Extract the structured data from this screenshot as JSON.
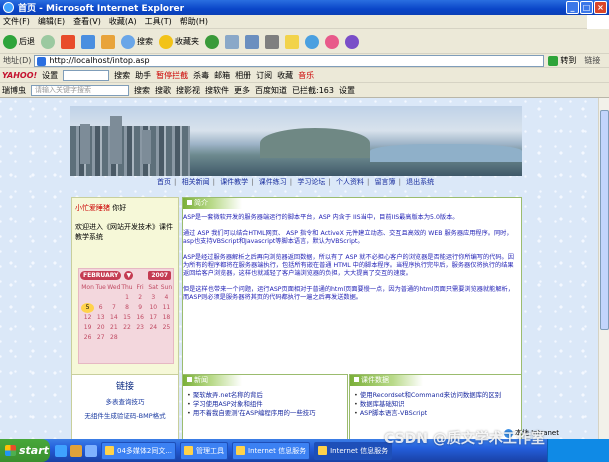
{
  "window": {
    "title": "首页 - Microsoft Internet Explorer"
  },
  "menu": [
    "文件(F)",
    "编辑(E)",
    "查看(V)",
    "收藏(A)",
    "工具(T)",
    "帮助(H)"
  ],
  "toolbar": {
    "back": "后退",
    "search": "搜索",
    "favorites": "收藏夹"
  },
  "address": {
    "label": "地址(D)",
    "url": "http://localhost/intop.asp",
    "go": "转到",
    "links": "链接"
  },
  "yahoo": {
    "logo": "YAHOO!",
    "settings": "设置",
    "search": "搜索",
    "help": "助手",
    "block": "暂停拦截",
    "kill": "杀毒",
    "mail": "邮箱",
    "album": "相册",
    "read": "订阅",
    "collect": "收藏",
    "music": "音乐"
  },
  "baidu": {
    "name": "瑞博虫",
    "placeholder": "请输入关键字搜索",
    "search": "搜索",
    "video": "搜歌",
    "pic": "搜影视",
    "soft": "搜软件",
    "more": "更多",
    "wiki": "百度知道",
    "registered": "已拦截:163",
    "setting": "设置"
  },
  "nav": [
    "首页",
    "相关新闻",
    "课件教学",
    "课件练习",
    "学习论坛",
    "个人资料",
    "留言簿",
    "退出系统"
  ],
  "welcome": {
    "user": "小忙爱睡猪",
    "greeting": "你好"
  },
  "course_text": "欢迎进入《网站开发技术》课件教学系统",
  "calendar": {
    "month": "FEBRUARY",
    "year": "2007",
    "days_header": [
      "Mon",
      "Tue",
      "Wed",
      "Thu",
      "Fri",
      "Sat",
      "Sun"
    ],
    "days": [
      "",
      "",
      "",
      "1",
      "2",
      "3",
      "4",
      "5",
      "6",
      "7",
      "8",
      "9",
      "10",
      "11",
      "12",
      "13",
      "14",
      "15",
      "16",
      "17",
      "18",
      "19",
      "20",
      "21",
      "22",
      "23",
      "24",
      "25",
      "26",
      "27",
      "28",
      "",
      "",
      "",
      ""
    ],
    "today": "5"
  },
  "intro": {
    "title": "简介",
    "paragraphs": [
      "ASP是一套微软开发的服务器端运行的脚本平台，ASP 内含于 IIS当中，目前IIS最高版本为5.0版本。",
      "通过 ASP 我们可以结合HTML网页、 ASP 指令和 ActiveX 元件建立动态、交互且高效的 WEB 服务器应用程序。同时，asp也支持VBScript和Javascript等脚本语言，默认为VBScript。",
      "ASP是经过服务器解析之后再向浏览器返回数据，所以有了 ASP 就不必担心客户的浏览器是否能运行你所编写的代码。因为所有的程序都将在服务器端执行，包括所有嵌在普通 HTML 中的脚本程序。当程序执行完毕后，服务器仅将执行的结果返回给客户浏览器，这样也就减轻了客户端浏览器的负担，大大提高了交互的速度。",
      "但是这样也带来一个问题，运行ASP页面相对于普通的html页面要慢一点，因为普通的html页面只需要浏览器就能解析，而ASP则必须是服务器将其页的代码都执行一遍之后再发送数据。"
    ]
  },
  "links": {
    "title": "链接",
    "items": [
      "多表查询技巧",
      "无组件生成验证码-BMP格式"
    ]
  },
  "news": {
    "title": "新闻",
    "items": [
      "聚软故弄.net名称的背后",
      "学习使用ASP对象和组件",
      "用不着我自要测'在ASP编程序用的一些技巧"
    ]
  },
  "course_data": {
    "title": "课件数据",
    "items": [
      "使用Recordset和Command来访问数据库的区别",
      "数据库基础知识",
      "ASP脚本语言-VBScript"
    ]
  },
  "status": {
    "zone": "本地 Intranet"
  },
  "taskbar": {
    "start": "start",
    "tasks": [
      "04多媒体2同文...",
      "管理工具",
      "Internet 信息服务",
      "Internet 信息服务"
    ]
  },
  "watermark": "CSDN @质文学术工作室"
}
